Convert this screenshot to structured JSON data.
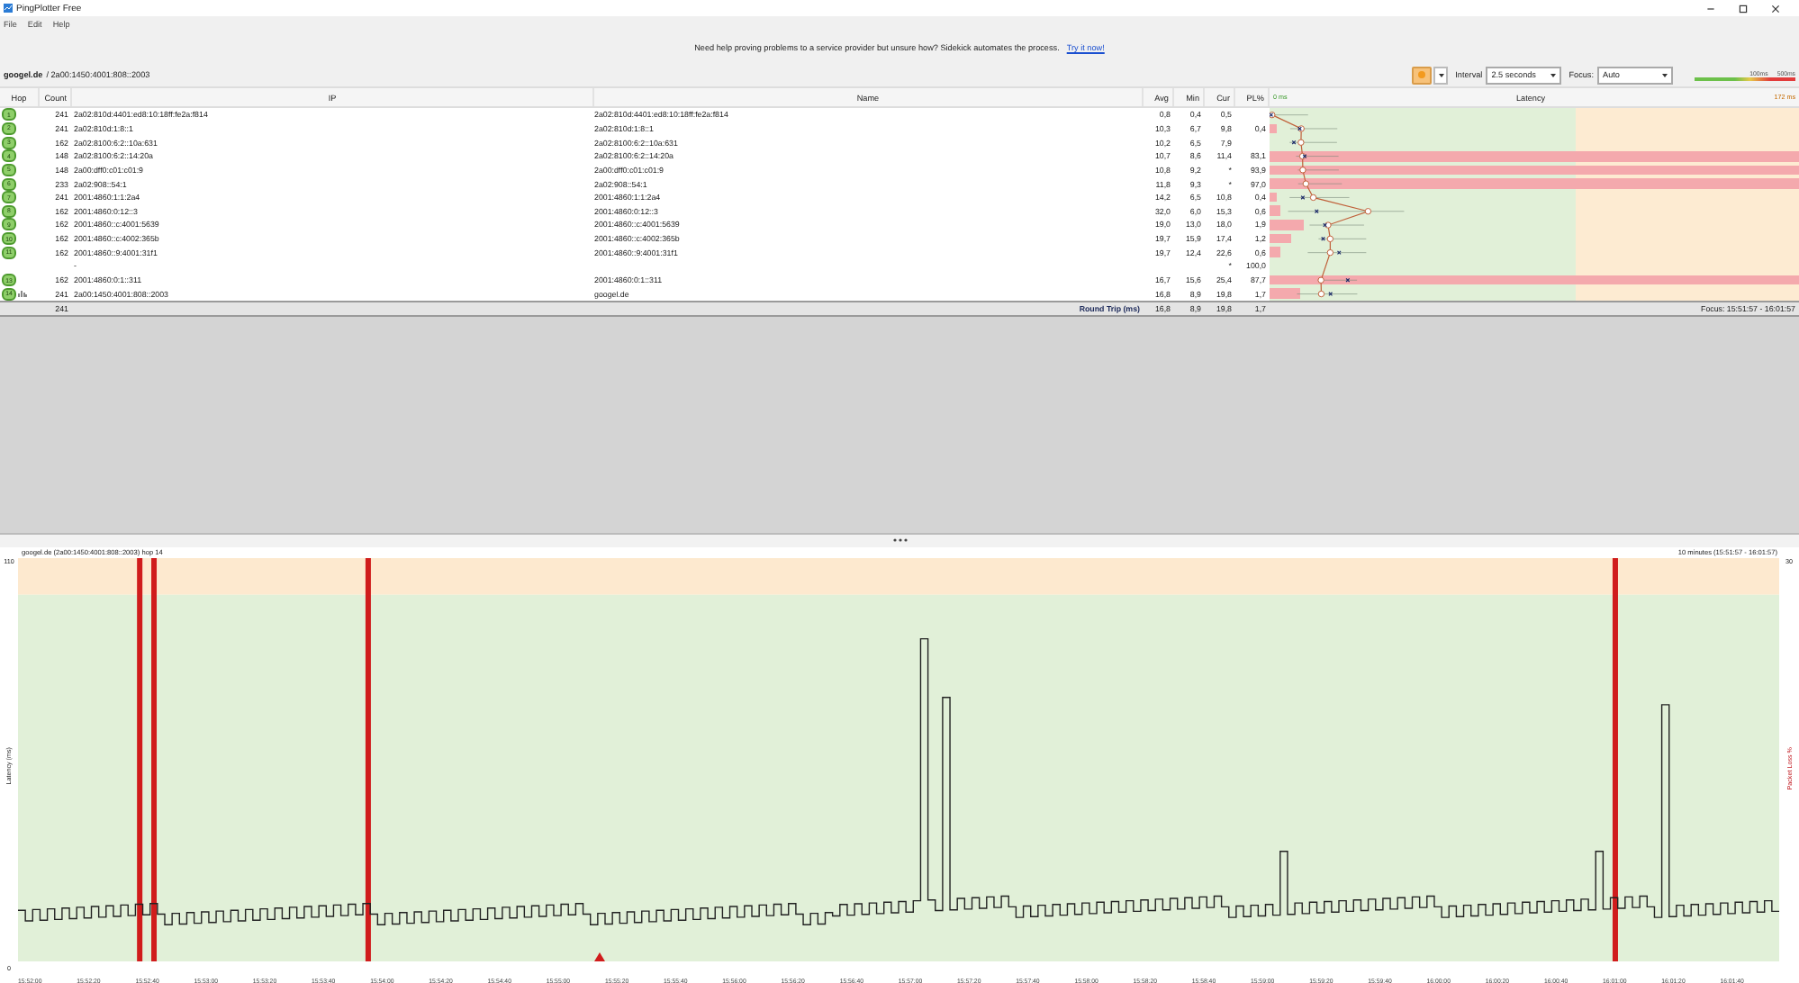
{
  "window": {
    "title": "PingPlotter Free"
  },
  "menu": [
    "File",
    "Edit",
    "Help"
  ],
  "banner": {
    "text": "Need help proving problems to a service provider but unsure how? Sidekick automates the process.",
    "link": "Try it now!"
  },
  "target": {
    "host": "googel.de",
    "address": "/ 2a00:1450:4001:808::2003"
  },
  "toolbar": {
    "interval_label": "Interval",
    "interval": "2.5 seconds",
    "focus_label": "Focus:",
    "focus": "Auto",
    "scale_labels": [
      "100ms",
      "500ms"
    ]
  },
  "table": {
    "columns": [
      "Hop",
      "Count",
      "IP",
      "Name",
      "Avg",
      "Min",
      "Cur",
      "PL%"
    ],
    "latency_min": "0 ms",
    "latency_title": "Latency",
    "latency_max": "172 ms",
    "rows": [
      {
        "hop": "1",
        "count": "241",
        "ip": "2a02:810d:4401:ed8:10:18ff:fe2a:f814",
        "name": "2a02:810d:4401:ed8:10:18ff:fe2a:f814",
        "avg": "0,8",
        "min": "0,4",
        "cur": "0,5",
        "graphed": false
      },
      {
        "hop": "2",
        "count": "241",
        "ip": "2a02:810d:1:8::1",
        "name": "2a02:810d:1:8::1",
        "avg": "10,3",
        "min": "6,7",
        "cur": "9,8",
        "pl": "0,4",
        "level": 0.013,
        "graphed": false
      },
      {
        "hop": "3",
        "count": "162",
        "ip": "2a02:8100:6:2::10a:631",
        "name": "2a02:8100:6:2::10a:631",
        "avg": "10,2",
        "min": "6,5",
        "cur": "7,9",
        "graphed": false
      },
      {
        "hop": "4",
        "count": "148",
        "ip": "2a02:8100:6:2::14:20a",
        "name": "2a02:8100:6:2::14:20a",
        "avg": "10,7",
        "min": "8,6",
        "cur": "11,4",
        "pl": "83,1",
        "level": 1,
        "graphed": false
      },
      {
        "hop": "5",
        "count": "148",
        "ip": "2a00:dff0:c01:c01:9",
        "name": "2a00:dff0:c01:c01:9",
        "avg": "10,8",
        "min": "9,2",
        "cur": "*",
        "pl": "93,9",
        "level": 1,
        "graphed": false
      },
      {
        "hop": "6",
        "count": "233",
        "ip": "2a02:908::54:1",
        "name": "2a02:908::54:1",
        "avg": "11,8",
        "min": "9,3",
        "cur": "*",
        "pl": "97,0",
        "level": 1,
        "graphed": false
      },
      {
        "hop": "7",
        "count": "241",
        "ip": "2001:4860:1:1:2a4",
        "name": "2001:4860:1:1:2a4",
        "avg": "14,2",
        "min": "6,5",
        "cur": "10,8",
        "pl": "0,4",
        "level": 0.013,
        "graphed": false
      },
      {
        "hop": "8",
        "count": "162",
        "ip": "2001:4860:0:12::3",
        "name": "2001:4860:0:12::3",
        "avg": "32,0",
        "min": "6,0",
        "cur": "15,3",
        "pl": "0,6",
        "level": 0.02,
        "graphed": false
      },
      {
        "hop": "9",
        "count": "162",
        "ip": "2001:4860::c:4001:5639",
        "name": "2001:4860::c:4001:5639",
        "avg": "19,0",
        "min": "13,0",
        "cur": "18,0",
        "pl": "1,9",
        "level": 0.063,
        "graphed": false
      },
      {
        "hop": "10",
        "count": "162",
        "ip": "2001:4860::c:4002:365b",
        "name": "2001:4860::c:4002:365b",
        "avg": "19,7",
        "min": "15,9",
        "cur": "17,4",
        "pl": "1,2",
        "level": 0.04,
        "graphed": false
      },
      {
        "hop": "11",
        "count": "162",
        "ip": "2001:4860::9:4001:31f1",
        "name": "2001:4860::9:4001:31f1",
        "avg": "19,7",
        "min": "12,4",
        "cur": "22,6",
        "pl": "0,6",
        "level": 0.02,
        "graphed": false
      },
      {
        "ip": "-",
        "cur": "*",
        "pl": "100,0",
        "graphed": false
      },
      {
        "hop": "13",
        "count": "162",
        "ip": "2001:4860:0:1::311",
        "name": "2001:4860:0:1::311",
        "avg": "16,7",
        "min": "15,6",
        "cur": "25,4",
        "pl": "87,7",
        "level": 1,
        "graphed": false
      },
      {
        "hop": "14",
        "count": "241",
        "ip": "2a00:1450:4001:808::2003",
        "name": "googel.de",
        "avg": "16,8",
        "min": "8,9",
        "cur": "19,8",
        "pl": "1,7",
        "level": 0.057,
        "graphed": true
      }
    ],
    "footer": {
      "count": "241",
      "label": "Round Trip (ms)",
      "avg": "16,8",
      "min": "8,9",
      "cur": "19,8",
      "pl": "1,7",
      "focus": "Focus: 15:51:57 - 16:01:57"
    }
  },
  "graph": {
    "title": "googel.de (2a00:1450:4001:808::2003) hop 14",
    "range": "10 minutes (15:51:57 - 16:01:57)",
    "y_max": "110",
    "y_min": "0",
    "y2_max": "30",
    "ylabel": "Latency (ms)",
    "y2label": "Packet Loss %",
    "time_labels": [
      "15:52:00",
      "15:52:20",
      "15:52:40",
      "15:53:00",
      "15:53:20",
      "15:53:40",
      "15:54:00",
      "15:54:20",
      "15:54:40",
      "15:55:00",
      "15:55:20",
      "15:55:40",
      "15:56:00",
      "15:56:20",
      "15:56:40",
      "15:57:00",
      "15:57:20",
      "15:57:40",
      "15:58:00",
      "15:58:20",
      "15:58:40",
      "15:59:00",
      "15:59:20",
      "15:59:40",
      "16:00:00",
      "16:00:20",
      "16:00:40",
      "16:01:00",
      "16:01:20",
      "16:01:40"
    ]
  }
}
